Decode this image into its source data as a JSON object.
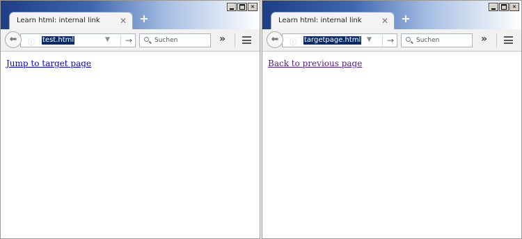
{
  "windows": [
    {
      "tab_title": "Learn html: internal link",
      "url": "test.html",
      "search_placeholder": "Suchen",
      "link_text": "Jump to target page"
    },
    {
      "tab_title": "Learn html: internal link",
      "url": "targetpage.html",
      "search_placeholder": "Suchen",
      "link_text": "Back to previous page"
    }
  ],
  "icons": {
    "back": "arrow-left-icon",
    "close_tab": "close-icon",
    "new_tab": "plus-icon",
    "go": "arrow-right-icon",
    "search": "magnifier-icon",
    "overflow": "double-chevron-icon",
    "menu": "hamburger-icon"
  }
}
